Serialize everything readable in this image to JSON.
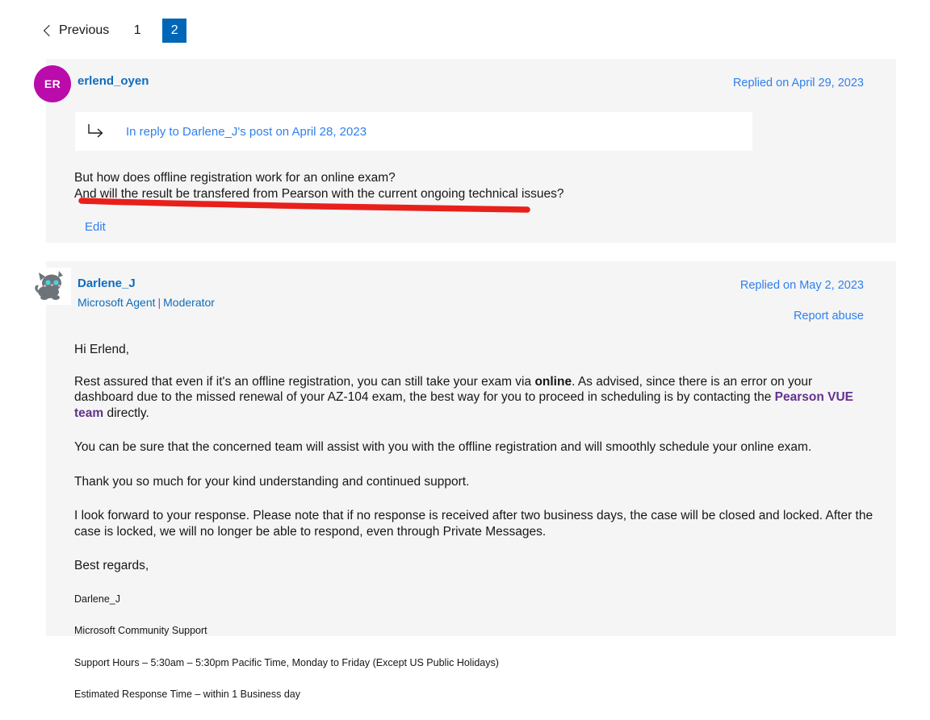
{
  "pagination": {
    "previous_label": "Previous",
    "previous_icon": "chevron-left-icon",
    "pages": [
      {
        "label": "1",
        "active": false
      },
      {
        "label": "2",
        "active": true
      }
    ],
    "active_color": "#0067b8"
  },
  "posts": [
    {
      "author": "erlend_oyen",
      "avatar_type": "initials",
      "avatar_initials": "ER",
      "avatar_color": "#ba0bab",
      "replied_on": "Replied on April 29, 2023",
      "quote": {
        "icon": "reply-arrow-icon",
        "text": "In reply to Darlene_J's post on April 28, 2023"
      },
      "body_line_1": "But how does offline registration work for an online exam?",
      "body_line_2": "And will the result be transfered from Pearson with the current ongoing technical issues?",
      "annotation": {
        "type": "red-underline-stroke",
        "color": "#e8201c"
      },
      "edit_label": "Edit"
    },
    {
      "author": "Darlene_J",
      "avatar_type": "image",
      "avatar_icon": "cat-avatar-icon",
      "role_primary": "Microsoft Agent",
      "role_separator": "|",
      "role_secondary": "Moderator",
      "replied_on": "Replied on May 2, 2023",
      "report_abuse": "Report abuse",
      "greeting": "Hi Erlend,",
      "paragraph_2_part_1": "Rest assured that even if it's an offline registration, you can still take your exam via ",
      "paragraph_2_bold": "online",
      "paragraph_2_part_2": ". As advised, since there is an error on your dashboard due to the missed renewal of your AZ-104 exam, the best way for you to proceed in scheduling is by contacting the ",
      "paragraph_2_link": "Pearson VUE team",
      "paragraph_2_part_3": " directly.",
      "paragraph_3": "You can be sure that the concerned team will assist with you with the offline registration and will smoothly schedule your online exam.",
      "paragraph_4": "Thank you so much for your kind understanding and continued support.",
      "paragraph_5": "I look forward to your response. Please note that if no response is received after two business days, the case will be closed and locked. After the case is locked, we will no longer be able to respond, even through Private Messages.",
      "paragraph_6": "Best regards,",
      "signature": [
        "Darlene_J",
        "Microsoft Community Support",
        "Support Hours – 5:30am – 5:30pm Pacific Time, Monday to Friday (Except US Public Holidays)",
        "Estimated Response Time – within 1 Business day"
      ]
    }
  ],
  "colors": {
    "link": "#2f80ed",
    "author_link": "#0f6cbd",
    "purple_link": "#63318e",
    "card_bg": "#f5f5f5",
    "annotation_red": "#e8201c"
  }
}
